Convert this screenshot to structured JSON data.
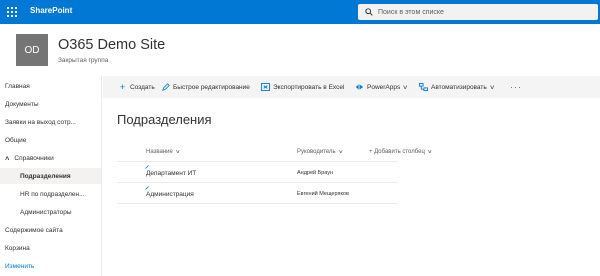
{
  "suite": {
    "brand": "SharePoint",
    "search_placeholder": "Поиск в этом списке"
  },
  "site": {
    "logo_initials": "OD",
    "title": "O365 Demo Site",
    "subtitle": "Закрытая группа"
  },
  "nav": {
    "items": [
      {
        "label": "Главная"
      },
      {
        "label": "Документы"
      },
      {
        "label": "Заявки на выход сотр..."
      },
      {
        "label": "Общие"
      },
      {
        "label": "Справочники"
      },
      {
        "label": "Подразделения"
      },
      {
        "label": "HR по подразделен..."
      },
      {
        "label": "Администраторы"
      },
      {
        "label": "Содержимое сайта"
      },
      {
        "label": "Корзина"
      },
      {
        "label": "Изменить"
      }
    ]
  },
  "command_bar": {
    "new": "Создать",
    "quick_edit": "Быстрое редактирование",
    "export_excel": "Экспортировать в Excel",
    "powerapps": "PowerApps",
    "automate": "Автоматизировать",
    "more": "···"
  },
  "list": {
    "title": "Подразделения",
    "columns": {
      "name": "Название",
      "head": "Руководитель",
      "add": "Добавить столбец"
    },
    "rows": [
      {
        "name": "Департамент ИТ",
        "head": "Андрей Браун"
      },
      {
        "name": "Администрация",
        "head": "Евгений Мещеряков"
      }
    ]
  },
  "colors": {
    "accent": "#0078d4",
    "command_bar_bg": "#f4f4f4",
    "logo_bg": "#757575"
  }
}
